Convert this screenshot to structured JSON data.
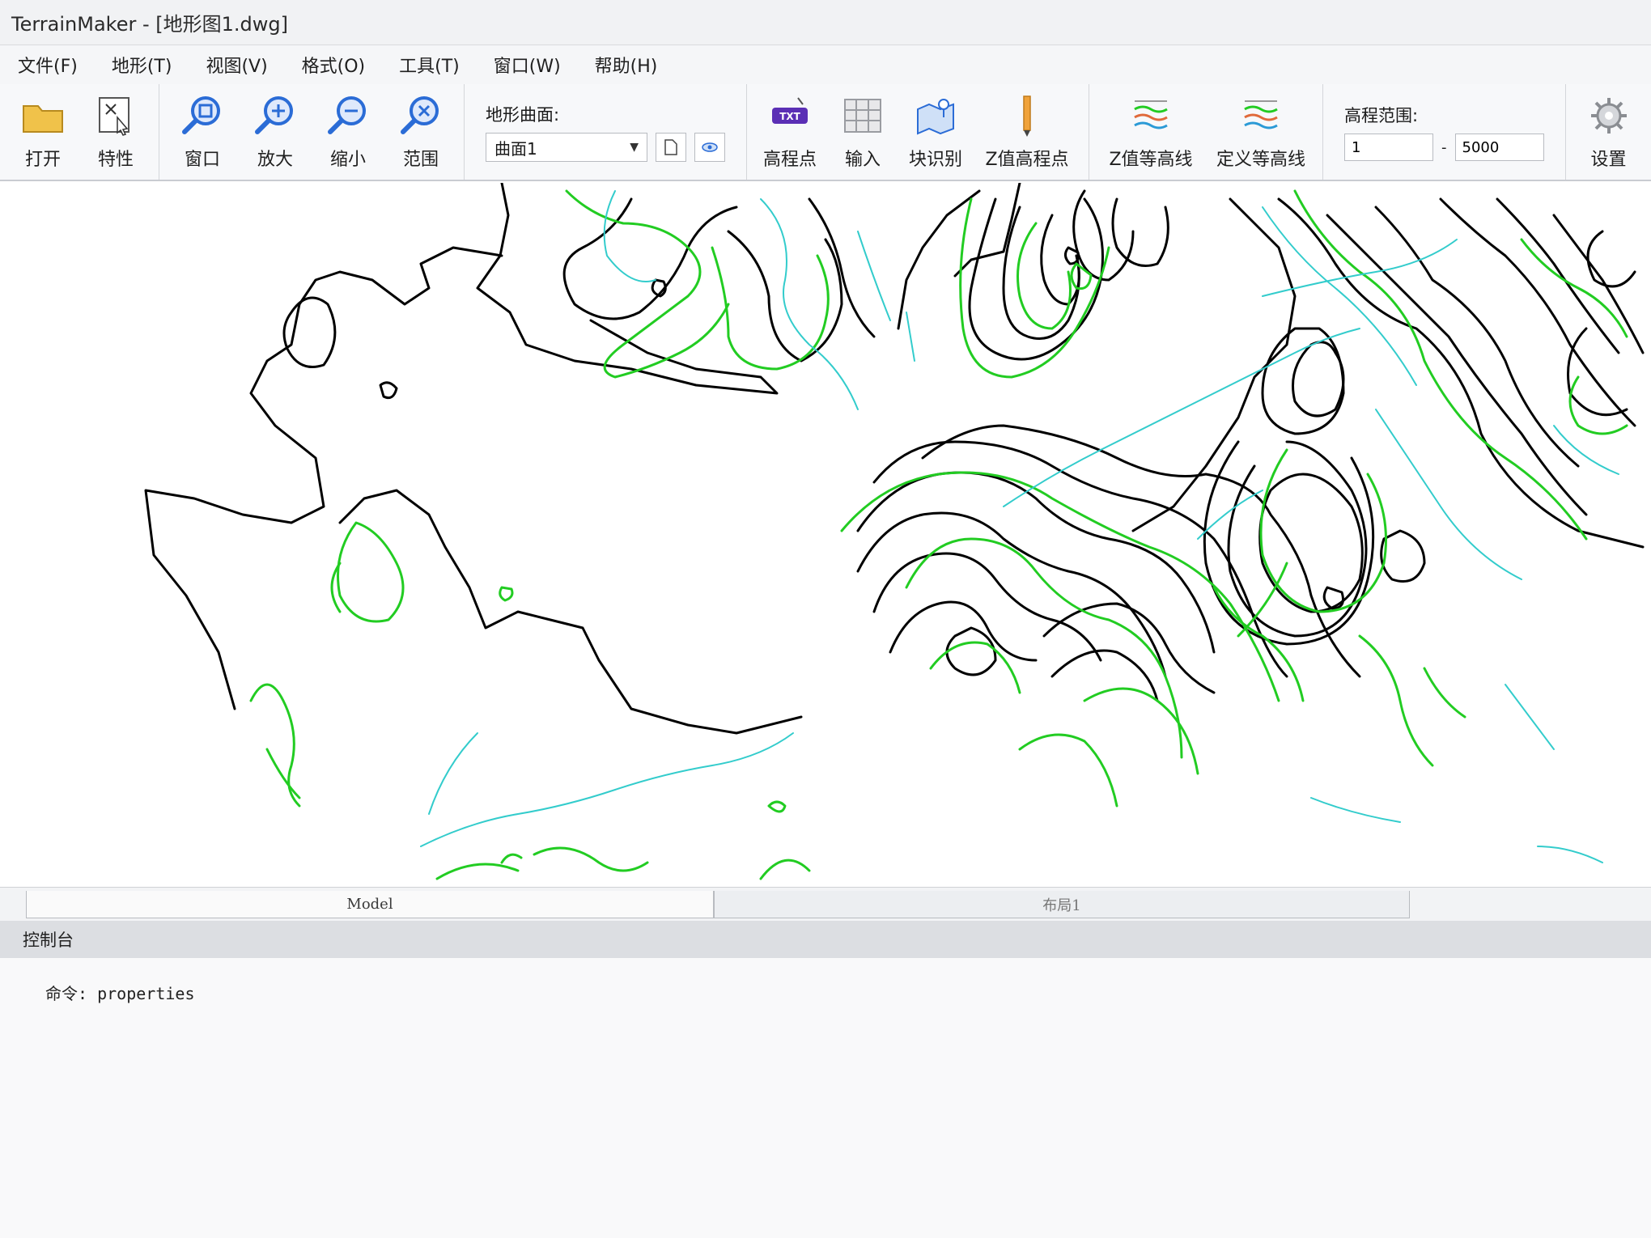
{
  "window": {
    "title": "TerrainMaker - [地形图1.dwg]"
  },
  "menu": [
    {
      "label": "文件(F)"
    },
    {
      "label": "地形(T)"
    },
    {
      "label": "视图(V)"
    },
    {
      "label": "格式(O)"
    },
    {
      "label": "工具(T)"
    },
    {
      "label": "窗口(W)"
    },
    {
      "label": "帮助(H)"
    }
  ],
  "toolbar": {
    "open": "打开",
    "properties": "特性",
    "zoom_window": "窗口",
    "zoom_in": "放大",
    "zoom_out": "缩小",
    "zoom_extent": "范围",
    "surface_label": "地形曲面:",
    "surface_value": "曲面1",
    "elevation_points": "高程点",
    "import": "输入",
    "block_recognize": "块识别",
    "z_elevation_points": "Z值高程点",
    "z_contours": "Z值等高线",
    "define_contours": "定义等高线",
    "range_label": "高程范围:",
    "range_min": "1",
    "range_max": "5000",
    "settings": "设置",
    "txt_badge": "TXT"
  },
  "tabs": {
    "model": "Model",
    "layout1": "布局1"
  },
  "console": {
    "title": "控制台",
    "command": "命令: properties"
  },
  "colors": {
    "contour_major": "#000000",
    "contour_green": "#22cc22",
    "contour_cyan": "#33cccc",
    "icon_blue": "#2b6cd6"
  }
}
